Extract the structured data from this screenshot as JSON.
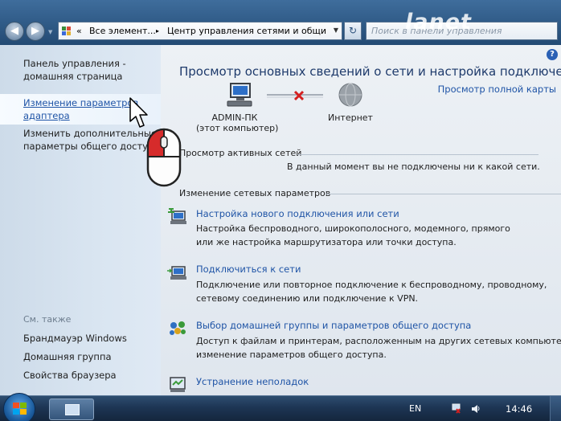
{
  "window": {
    "back_glyph": "◀",
    "forward_glyph": "▶",
    "breadcrumb_chevron": "«",
    "breadcrumb": [
      "Все элемент...",
      "Центр управления сетями и общи"
    ],
    "breadcrumb_sep": "▸",
    "address_dropdown": "▼",
    "refresh_glyph": "↻",
    "search_placeholder": "Поиск в панели управления",
    "brand_watermark": "lanet"
  },
  "sidebar": {
    "home_link": [
      "Панель управления -",
      "домашняя страница"
    ],
    "items": [
      {
        "label": [
          "Изменение параметров",
          "адаптера"
        ],
        "active": true
      },
      {
        "label": [
          "Изменить дополнительные",
          "параметры общего доступа"
        ],
        "active": false
      }
    ],
    "see_also_title": "См. также",
    "see_also": [
      "Брандмауэр Windows",
      "Домашняя группа",
      "Свойства браузера"
    ]
  },
  "main": {
    "help_glyph": "?",
    "title": "Просмотр основных сведений о сети и настройка подключений",
    "full_map_link": "Просмотр полной карты",
    "network_map": {
      "computer_name": "ADMIN-ПК",
      "computer_sub": "(этот компьютер)",
      "internet_label": "Интернет",
      "status": "disconnected"
    },
    "active_networks_title": "Просмотр активных сетей",
    "active_networks_status": "В данный момент вы не подключены ни к какой сети.",
    "change_settings_title": "Изменение сетевых параметров",
    "tasks": [
      {
        "icon": "new-connection-icon",
        "title": "Настройка нового подключения или сети",
        "desc": [
          "Настройка беспроводного, широкополосного, модемного, прямого",
          "или же настройка маршрутизатора или точки доступа."
        ]
      },
      {
        "icon": "connect-network-icon",
        "title": "Подключиться к сети",
        "desc": [
          "Подключение или повторное подключение к беспроводному, проводному,",
          "сетевому соединению или подключение к VPN."
        ]
      },
      {
        "icon": "homegroup-icon",
        "title": "Выбор домашней группы и параметров общего доступа",
        "desc": [
          "Доступ к файлам и принтерам, расположенным на других сетевых компьютерах,",
          "изменение параметров общего доступа."
        ]
      },
      {
        "icon": "troubleshoot-icon",
        "title": "Устранение неполадок",
        "desc": []
      }
    ]
  },
  "taskbar": {
    "language": "EN",
    "clock": "14:46"
  },
  "colors": {
    "link": "#1f54a6",
    "title": "#1e3a6b",
    "error_x": "#d42020"
  }
}
